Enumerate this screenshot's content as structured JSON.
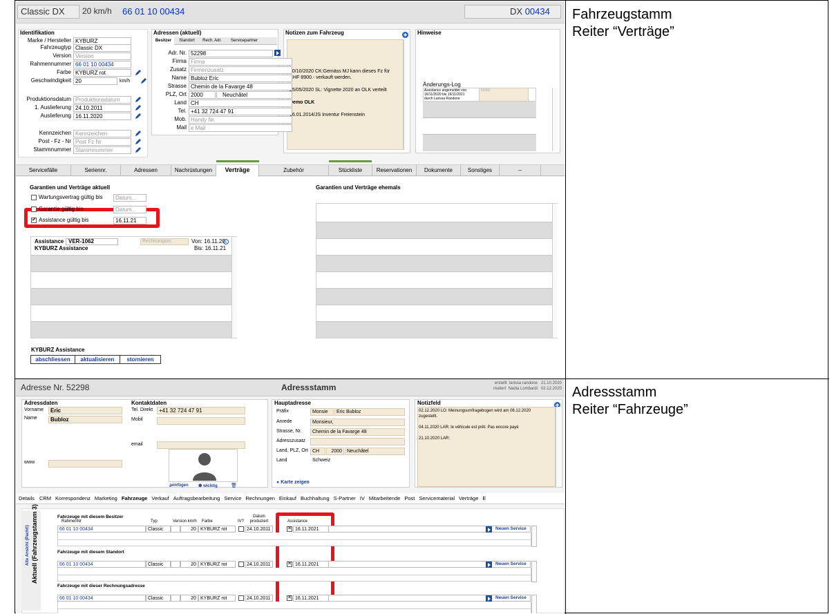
{
  "notes": {
    "top": [
      "Fahrzeugstamm",
      "Reiter “Verträge”"
    ],
    "bottom": [
      "Adressstamm",
      "Reiter “Fahrzeuge”"
    ]
  },
  "vehicle": {
    "title_model": "Classic DX",
    "title_speed": "20 km/h",
    "title_frame": "66 01 10 00434",
    "title_right_prefix": "DX",
    "title_right_num": "00434",
    "ident_title": "Identifikation",
    "fields": [
      {
        "label": "Marke / Hersteller",
        "value": "KYBURZ",
        "ph": false
      },
      {
        "label": "Fahrzeugtyp",
        "value": "Classic DX",
        "ph": false
      },
      {
        "label": "Version",
        "value": "Version",
        "ph": true
      },
      {
        "label": "Rahmennummer",
        "value": "66 01 10 00434",
        "ph": false,
        "blue": true
      },
      {
        "label": "Farbe",
        "value": "KYBURZ rot",
        "ph": false
      },
      {
        "label": "Geschwindigkeit",
        "value": "20",
        "ph": false
      },
      {
        "label": "Produktionsdatum",
        "value": "Produktionsdatum",
        "ph": true
      },
      {
        "label": "1. Auslieferung",
        "value": "24.10.2011",
        "ph": false
      },
      {
        "label": "Auslieferung",
        "value": "16.11.2020",
        "ph": false
      },
      {
        "label": "Kennzeichen",
        "value": "Kennzeichen",
        "ph": true
      },
      {
        "label": "Post - Fz - Nr",
        "value": "Post Fz Nr",
        "ph": true
      },
      {
        "label": "Stammnummer",
        "value": "Stammnummer",
        "ph": true
      }
    ],
    "speed_unit": "km/h",
    "addr_title": "Adressen (aktuell)",
    "addr_tabs": [
      "Besitzer",
      "Standort",
      "Rech. Adr.",
      "Servicepartner"
    ],
    "addr_fields": [
      {
        "label": "Adr. Nr.",
        "value": "52298",
        "ph": false
      },
      {
        "label": "Firma",
        "value": "Firma",
        "ph": true
      },
      {
        "label": "Zusatz",
        "value": "Firmenzusatz",
        "ph": true
      },
      {
        "label": "Name",
        "value": "Bubloz Eric",
        "ph": false
      },
      {
        "label": "Strasse",
        "value": "Chemin de la Favarge 48",
        "ph": false
      },
      {
        "label": "PLZ, Ort",
        "value": "2000",
        "value2": "Neuchâtel",
        "ph": false
      },
      {
        "label": "Land",
        "value": "CH",
        "ph": false
      },
      {
        "label": "Tel.",
        "value": "+41 32 724 47 91",
        "ph": false
      },
      {
        "label": "Mob.",
        "value": "Handy Nr.",
        "ph": true
      },
      {
        "label": "Mail",
        "value": "e Mail",
        "ph": true
      }
    ],
    "notes_title": "Notizen zum Fahrzeug",
    "notes_lines": [
      "20/10/2020 CK:Gemäss MJ kann dieses Fz für",
      "CHF 8900.- verkauft werden.",
      "",
      "25/05/2020 SL: Vignette 2020 an OLK verteilt",
      "",
      "Demo OLK",
      "",
      "06.01.2014/JS Inventur Freienstein"
    ],
    "hinweise_title": "Hinweise",
    "log_title": "Änderungs-Log",
    "log_text": [
      "Assistance angemeldet von",
      "16/11/2020 bis 16/11/2021",
      "durch Larissa Randone"
    ],
    "log_notiz": "Notiz",
    "tabs": [
      "Servicefälle",
      "Seriennr.",
      "Adressen",
      "Nachrüstungen",
      "Verträge",
      "Zubehör",
      "Stückliste",
      "Reservationen",
      "Dokumente",
      "Sonstiges",
      "--"
    ],
    "active_tab": "Verträge",
    "current_title": "Garantien und Verträge aktuell",
    "former_title": "Garantien und Verträge ehemals",
    "checks": [
      {
        "label": "Wartungsvertrag gültig bis",
        "value": "Datum...",
        "checked": false,
        "ph": true
      },
      {
        "label": "Garantie gültig bis",
        "value": "Datum...",
        "checked": false,
        "ph": true
      },
      {
        "label": "Assistance gültig bis",
        "value": "16.11.21",
        "checked": true,
        "ph": false
      }
    ],
    "contract": {
      "type": "Assistance",
      "number": "VER-1062",
      "invoice_ph": "Rechnungsnr.",
      "name": "KYBURZ Assistance",
      "from_label": "Von:",
      "from": "16.11.20",
      "to_label": "Bis:",
      "to": "16.11.21"
    },
    "footer_title": "KYBURZ Assistance",
    "buttons": [
      "abschliessen",
      "aktualisieren",
      "stornieren"
    ]
  },
  "address": {
    "title_prefix": "Adresse Nr.",
    "title_num": "52298",
    "center_title": "Adressstamm",
    "meta": [
      {
        "label": "erstellt",
        "who": "larissa randone",
        "date": "21.10.2020"
      },
      {
        "label": "mutiert",
        "who": "Nadia Lombardi",
        "date": "02.12.2020"
      }
    ],
    "addr_title": "Adressdaten",
    "vorname_label": "Vorname",
    "vorname": "Eric",
    "name_label": "Name",
    "name": "Bubloz",
    "www_label": "www",
    "contact_title": "Kontaktdaten",
    "tel_label": "Tel. Direkt",
    "tel": "+41 32 724 47 91",
    "mobil_label": "Mobil",
    "email_label": "email",
    "photo_insert": "einfügen",
    "photo_important": "wichtig",
    "main_title": "Hauptadresse",
    "main_fields": [
      {
        "label": "Präfix",
        "value": "Monsie",
        "value2": "Eric Bubloz"
      },
      {
        "label": "Anrede",
        "value": "Monsieur,"
      },
      {
        "label": "Strasse, Nr.",
        "value": "Chemin de la Favarge 48"
      },
      {
        "label": "Adresszusatz",
        "value": ""
      },
      {
        "label": "Land, PLZ, Ort",
        "value": "CH",
        "value2": "2000",
        "value3": "Neuchâtel"
      },
      {
        "label": "Land",
        "value": "Schweiz"
      }
    ],
    "map_button": "Karte zeigen",
    "notiz_title": "Notizfeld",
    "notiz_lines": [
      "02.12.2020 LO:  Meinungsumfragebogen wird am 08.12.2020",
      "zugestellt.",
      "",
      "04.11.2020 LAR: le véhicule est prêt. Pas encore payé",
      "",
      "21.10.2020 LAR:"
    ],
    "tabs": [
      "Details",
      "CRM",
      "Korrespondenz",
      "Marketing",
      "Fahrzeuge",
      "Verkauf",
      "Auftragsbearbeitung",
      "Service",
      "Rechnungen",
      "Einkauf",
      "Buchhaltung",
      "S-Partner",
      "IV",
      "Mitarbeitende",
      "Post",
      "Servicematerial",
      "Verträge",
      "E"
    ],
    "active_tab": "Fahrzeuge",
    "side_label_1": "Aktuell (Fahrzeugstamm 3)",
    "side_label_2": "Alte Ansicht (Pacht!)",
    "col_headers": {
      "rahmen": "RahmenNr",
      "typ": "Typ",
      "version": "Version km/h",
      "farbe": "Farbe",
      "iv": "IV?",
      "datum": "Datum produziert",
      "assistance": "Assistance"
    },
    "groups": [
      {
        "title": "Fahrzeuge mit diesem Besitzer",
        "rahmen": "66 01 10 00434",
        "typ": "Classic",
        "kmh": "20",
        "farbe": "KYBURZ rot",
        "datum": "24.10.2011",
        "assistance": "16.11.2021",
        "service": "Neuen Service"
      },
      {
        "title": "Fahrzeuge mit diesem Standort",
        "rahmen": "66 01 10 00434",
        "typ": "Classic",
        "kmh": "20",
        "farbe": "KYBURZ rot",
        "datum": "24.10.2011",
        "assistance": "16.11.2021",
        "service": "Neuen Service"
      },
      {
        "title": "Fahrzeuge mit dieser Rechnungsadresse",
        "rahmen": "66 01 10 00434",
        "typ": "Classic",
        "kmh": "20",
        "farbe": "KYBURZ rot",
        "datum": "24.10.2011",
        "assistance": "16.11.2021",
        "service": "Neuen Service"
      }
    ]
  },
  "colors": {
    "highlight": "#e8141b",
    "link_blue": "#0033cc",
    "note_beige": "#f3ead7",
    "tab_green": "#6a9a3c"
  }
}
